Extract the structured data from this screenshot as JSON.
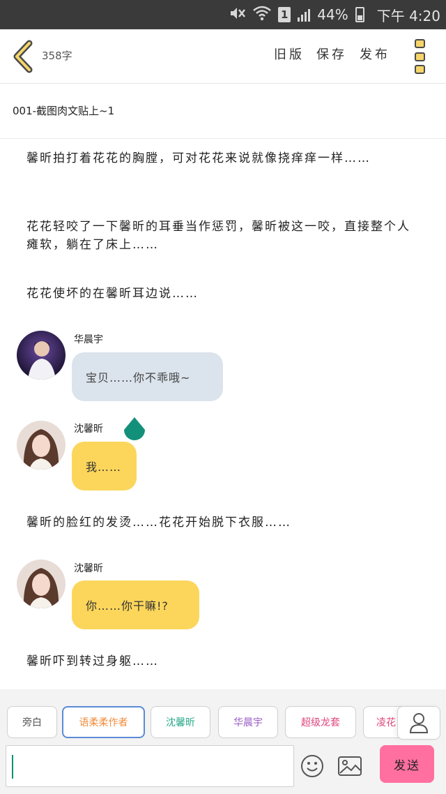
{
  "status_bar": {
    "battery": "44%",
    "time": "下午 4:20",
    "sim_label": "1"
  },
  "toolbar": {
    "word_count": "358字",
    "old_version": "旧版",
    "save": "保存",
    "publish": "发布"
  },
  "chapter": {
    "title": "001-截图肉文贴上~1"
  },
  "story": {
    "narration_1": "馨昕拍打着花花的胸膛，可对花花来说就像挠痒痒一样……",
    "narration_2": "花花轻咬了一下馨昕的耳垂当作惩罚，馨昕被这一咬，直接整个人瘫软，躺在了床上……",
    "narration_3": "花花使坏的在馨昕耳边说……",
    "msg_1": {
      "speaker": "华晨宇",
      "text": "宝贝……你不乖哦~"
    },
    "msg_2": {
      "speaker": "沈馨昕",
      "text": "我……"
    },
    "narration_4": "馨昕的脸红的发烫……花花开始脱下衣服……",
    "msg_3": {
      "speaker": "沈馨昕",
      "text": "你……你干嘛!?"
    },
    "narration_5": "馨昕吓到转过身躯……"
  },
  "roles": {
    "chips": [
      {
        "label": "旁白",
        "color": "#555555"
      },
      {
        "label": "语柔柔作者",
        "color": "#f08c3c"
      },
      {
        "label": "沈馨昕",
        "color": "#2aa88a"
      },
      {
        "label": "华晨宇",
        "color": "#9a5cc6"
      },
      {
        "label": "超级龙套",
        "color": "#e0467c"
      },
      {
        "label": "凌花",
        "color": "#e0467c"
      }
    ]
  },
  "composer": {
    "placeholder": "",
    "send": "发送"
  },
  "colors": {
    "accent_yellow": "#fcd65b",
    "bubble_blue": "#dbe3ec",
    "send_pink": "#ff6fa0",
    "drop_teal": "#12907a"
  }
}
